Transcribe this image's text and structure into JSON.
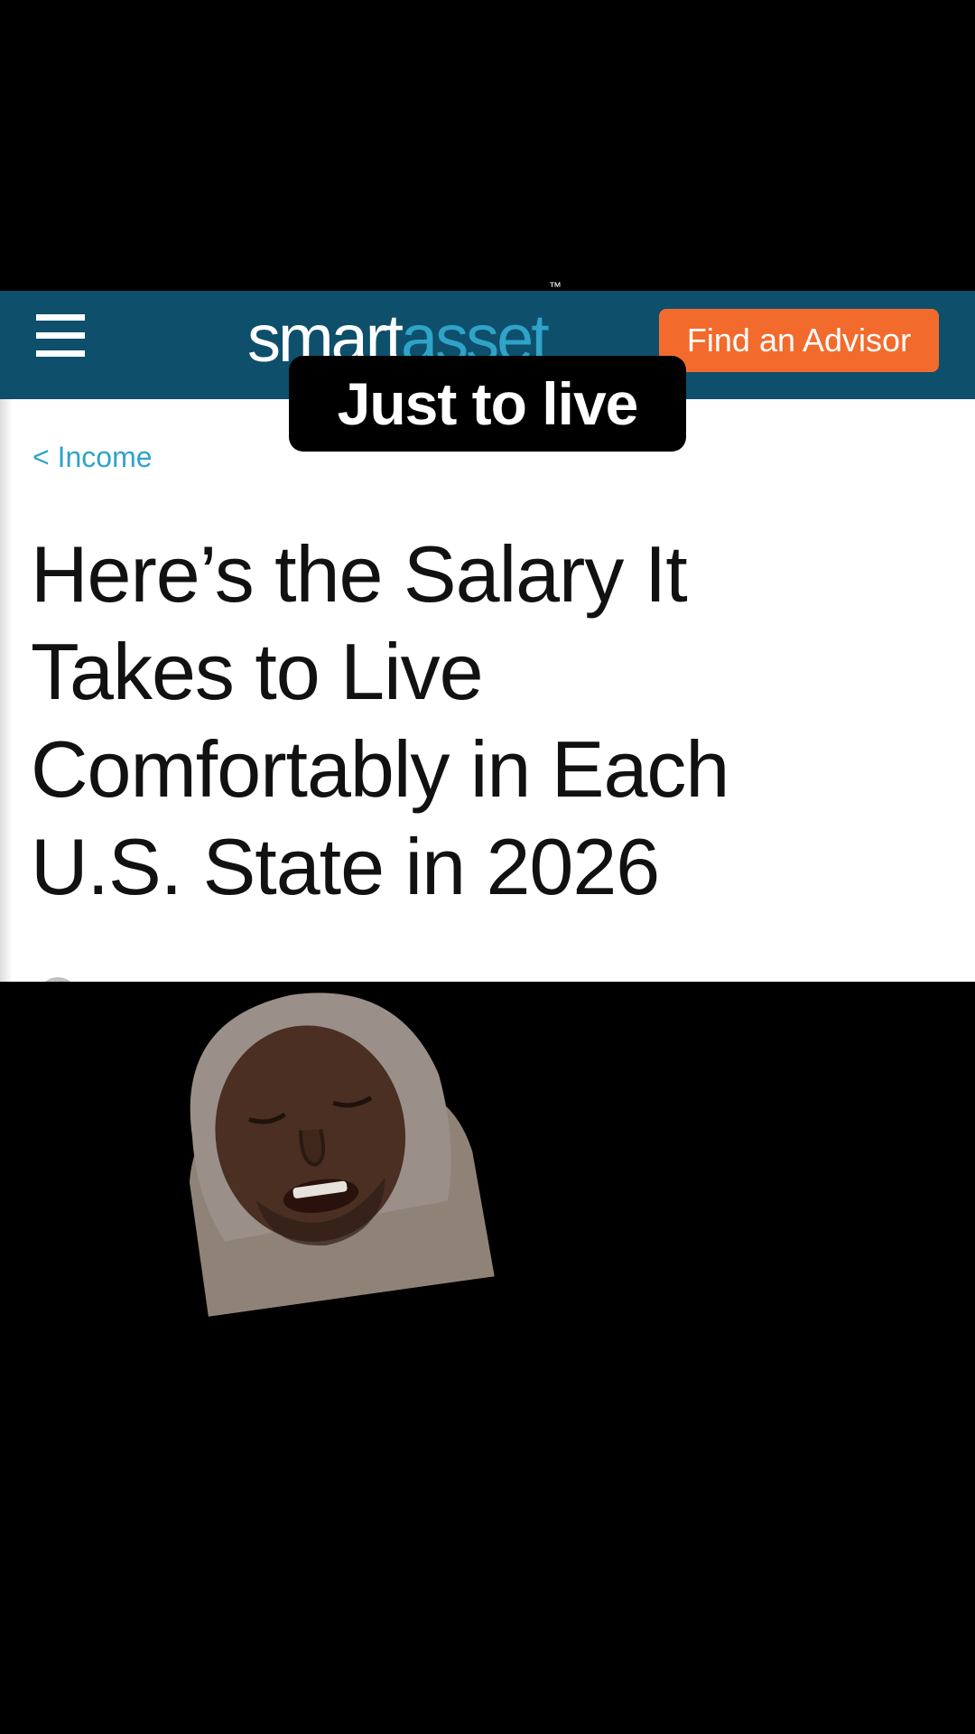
{
  "header": {
    "logo_part1": "smart",
    "logo_part2": "asset",
    "logo_tm": "™",
    "advisor_button_label": "Find an Advisor"
  },
  "article": {
    "breadcrumb": "< Income",
    "title": "Here’s the Salary It Takes to Live Comfortably in Each U.S. State in 2026"
  },
  "caption": "Just to live",
  "colors": {
    "header_bg": "#0e4f6b",
    "logo_accent": "#2fa3c9",
    "button_bg": "#f26b2d",
    "page_bg": "#000000"
  },
  "icons": [
    "hamburger-menu-icon"
  ]
}
